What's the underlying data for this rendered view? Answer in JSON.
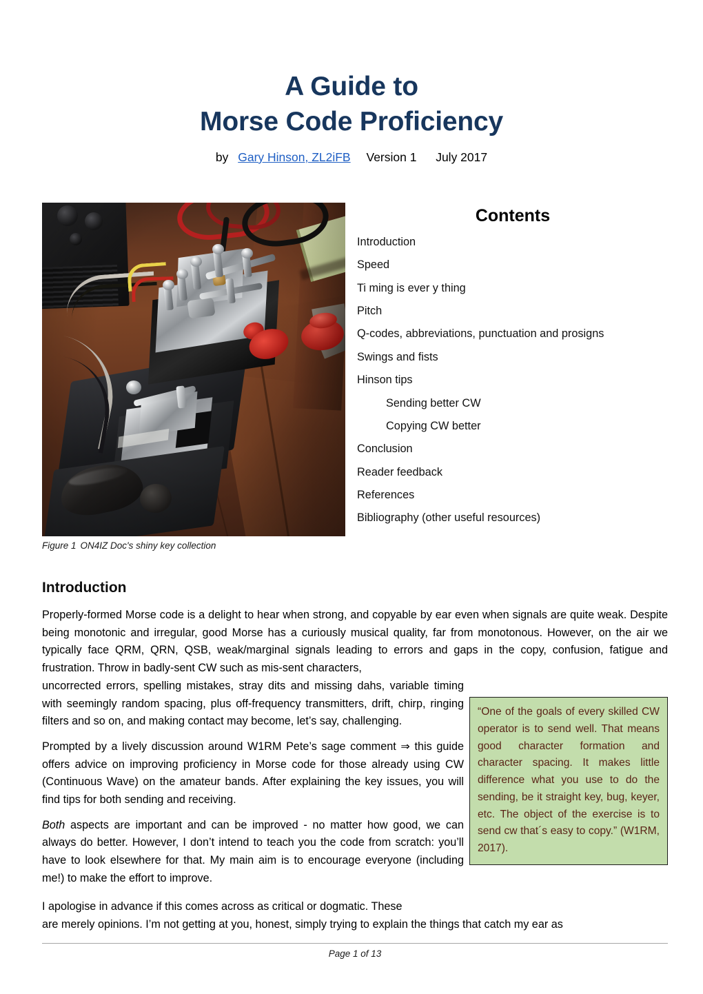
{
  "document": {
    "title_line_1": "A Guide to",
    "title_line_2": "Morse Code Proficiency",
    "byline_prefix": "by",
    "author_link": "Gary Hinson, ZL2iFB",
    "version": "Version 1",
    "date": "July 2017",
    "title_color": "#17365d",
    "link_color": "#1f5fc4"
  },
  "figure": {
    "caption_label": "Figure 1",
    "caption_text": "ON4IZ Doc's shiny key collection",
    "alt": "Photograph of polished chrome Morse keys and paddles on a dark wooden desk with a black radio, red knobs and cables"
  },
  "contents": {
    "heading": "Contents",
    "items": [
      {
        "label": "Introduction",
        "level": 0
      },
      {
        "label": "Speed",
        "level": 0
      },
      {
        "label": "Ti ming is ever y thing",
        "level": 0
      },
      {
        "label": "Pitch",
        "level": 0
      },
      {
        "label": "Q-codes, abbreviations, punctuation and prosigns",
        "level": 0
      },
      {
        "label": "Swings and fists",
        "level": 0
      },
      {
        "label": "Hinson tips",
        "level": 0
      },
      {
        "label": "Sending better CW",
        "level": 1
      },
      {
        "label": "Copying CW better",
        "level": 1
      },
      {
        "label": "Conclusion",
        "level": 0
      },
      {
        "label": "Reader feedback",
        "level": 0
      },
      {
        "label": "References",
        "level": 0
      },
      {
        "label": "Bibliography (other useful resources)",
        "level": 0
      }
    ]
  },
  "introduction": {
    "heading": "Introduction",
    "para_1_wide": "Properly-formed Morse code is a delight to hear when strong, and copyable by ear even when signals are quite weak.  Despite being monotonic and irregular, good Morse has a curiously musical quality, far from monotonous.  However, on the air we typically face QRM, QRN, QSB, weak/marginal signals leading to errors and gaps in the copy, confusion, fatigue and frustration.  Throw in badly-sent CW such as mis-sent characters,",
    "para_1_narrow": "uncorrected errors, spelling mistakes, stray dits and missing dahs, variable timing with seemingly random spacing, plus off-frequency transmitters, drift, chirp, ringing filters and so on, and making contact may become, let’s say, challenging.",
    "para_2": "Prompted by a lively discussion around W1RM Pete’s sage comment ⇒ this guide offers advice on improving proficiency in Morse code for those already using CW (Continuous Wave) on the amateur bands.  After explaining the key issues, you will find tips for both sending and receiving.",
    "para_3_italic_lead": "Both",
    "para_3": " aspects are important and can be improved - no matter how good, we can always do better.  However, I don’t intend to teach you the code from scratch: you’ll have to look elsewhere for that.  My main aim is to encourage everyone (including me!) to make the effort to improve.",
    "para_4_line_1": "I apologise in advance if this comes across as critical or dogmatic.  These",
    "para_4_line_2": "are merely opinions.  I’m not getting at you, honest, simply trying to explain the things that catch my ear as"
  },
  "callout": {
    "text": "“One of the goals of every skilled CW operator is to send well.    That means good character formation and character spacing.  It makes little difference what you use to do the sending, be it straight key, bug, keyer, etc.  The object of the exercise is to send cw that´s easy to copy.” (W1RM, 2017).",
    "background_color": "#c3ddac",
    "text_color": "#5a2417",
    "border_color": "#1c1c1c"
  },
  "footer": {
    "page_text": "Page 1 of 13"
  }
}
